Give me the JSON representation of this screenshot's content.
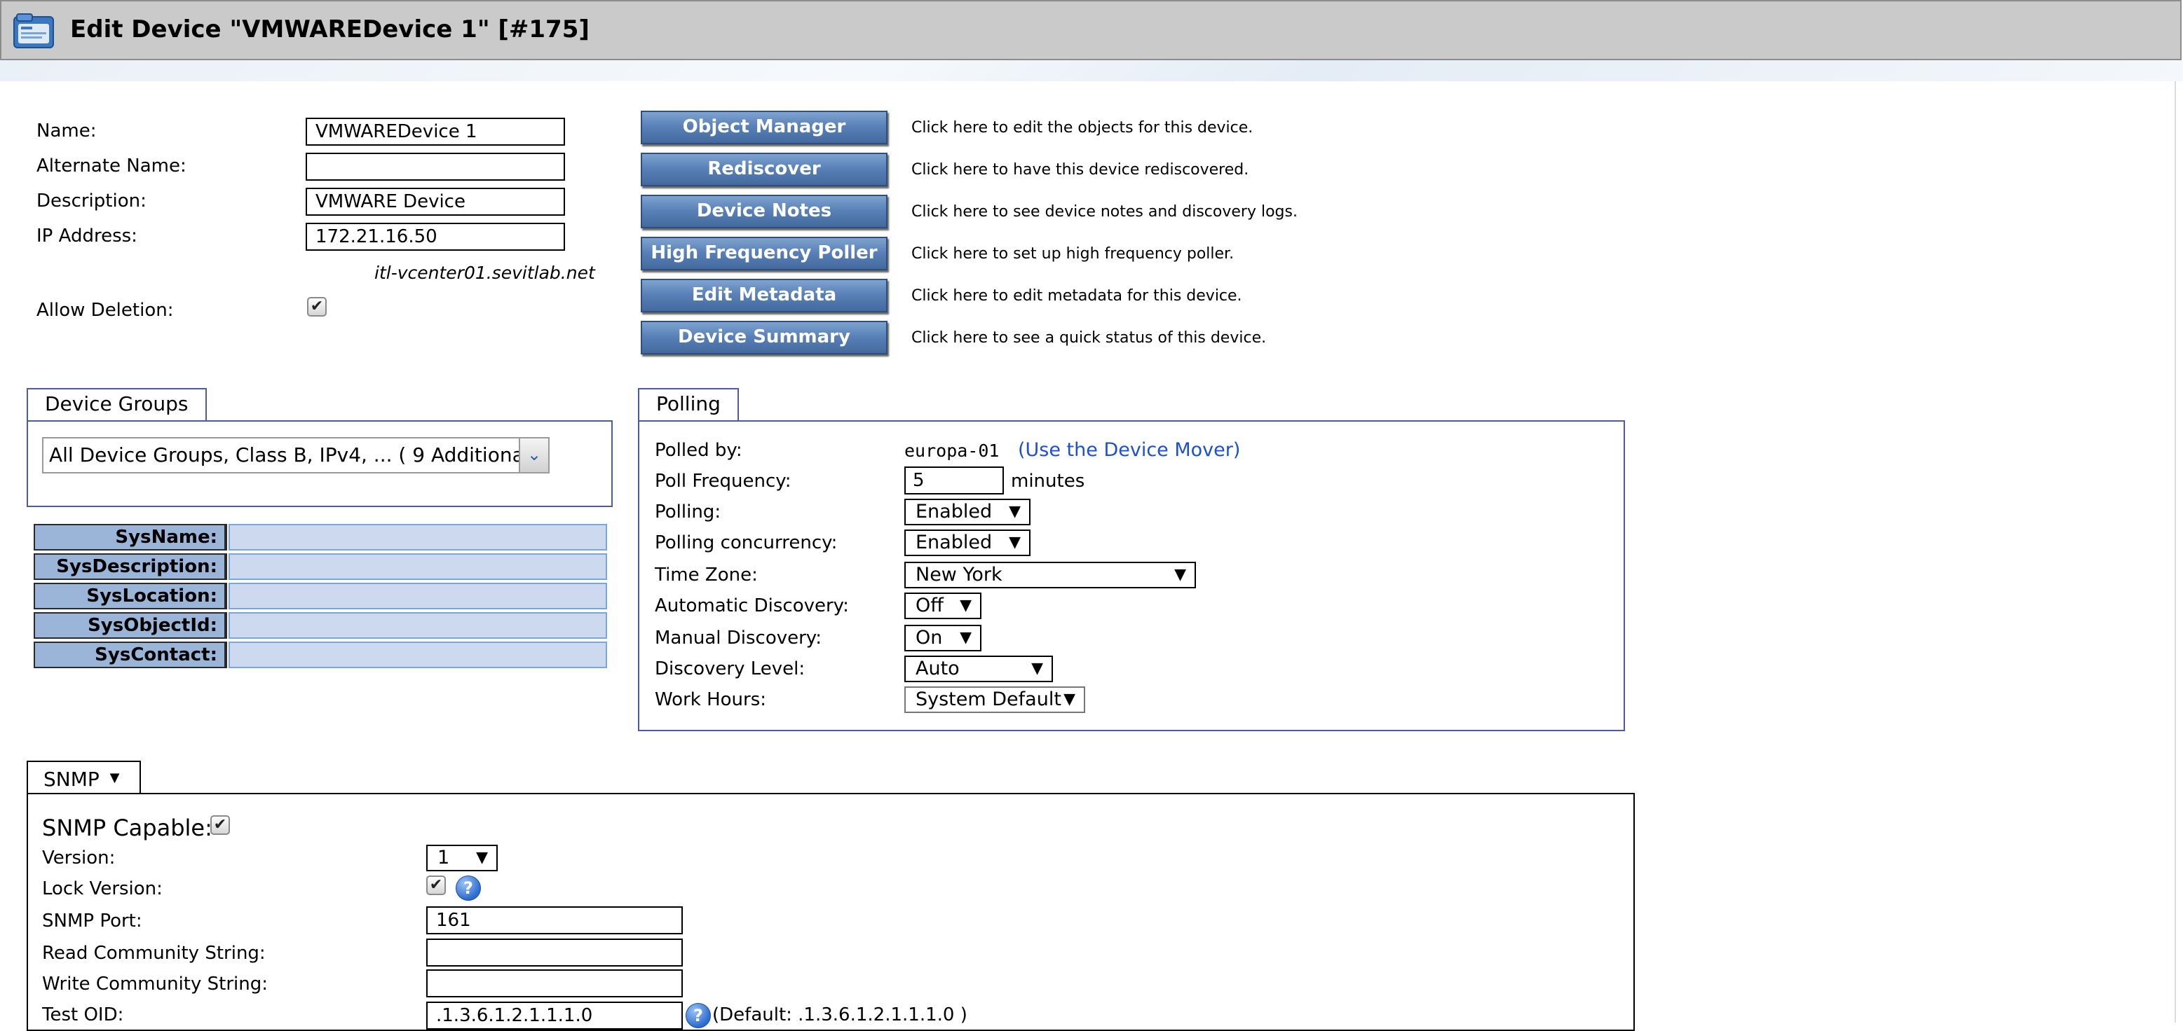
{
  "window": {
    "title": "Edit Device \"VMWAREDevice 1\" [#175]",
    "icon": "device-folder-icon"
  },
  "device_form": {
    "name_label": "Name:",
    "name_value": "VMWAREDevice 1",
    "alt_name_label": "Alternate Name:",
    "alt_name_value": "",
    "description_label": "Description:",
    "description_value": "VMWARE Device",
    "ip_label": "IP Address:",
    "ip_value": "172.21.16.50",
    "hostname": "itl-vcenter01.sevitlab.net",
    "allow_deletion_label": "Allow Deletion:",
    "allow_deletion_checked": true
  },
  "actions": [
    {
      "label": "Object Manager",
      "desc": "Click here to edit the objects for this device."
    },
    {
      "label": "Rediscover",
      "desc": "Click here to have this device rediscovered."
    },
    {
      "label": "Device Notes",
      "desc": "Click here to see device notes and discovery logs."
    },
    {
      "label": "High Frequency Poller",
      "desc": "Click here to set up high frequency poller."
    },
    {
      "label": "Edit Metadata",
      "desc": "Click here to edit metadata for this device."
    },
    {
      "label": "Device Summary",
      "desc": "Click here to see a quick status of this device."
    }
  ],
  "device_groups": {
    "tab_label": "Device Groups",
    "selected": "All Device Groups, Class B, IPv4, ... ( 9 Additional"
  },
  "sys_info": [
    {
      "label": "SysName:",
      "value": ""
    },
    {
      "label": "SysDescription:",
      "value": ""
    },
    {
      "label": "SysLocation:",
      "value": ""
    },
    {
      "label": "SysObjectId:",
      "value": ""
    },
    {
      "label": "SysContact:",
      "value": ""
    }
  ],
  "polling": {
    "tab_label": "Polling",
    "polled_by_label": "Polled by:",
    "polled_by_value": "europa-01",
    "device_mover_link": "(Use the Device Mover)",
    "poll_frequency_label": "Poll Frequency:",
    "poll_frequency_value": "5",
    "poll_frequency_unit": "minutes",
    "polling_label": "Polling:",
    "polling_value": "Enabled",
    "concurrency_label": "Polling concurrency:",
    "concurrency_value": "Enabled",
    "timezone_label": "Time Zone:",
    "timezone_value": "New York",
    "auto_discovery_label": "Automatic Discovery:",
    "auto_discovery_value": "Off",
    "manual_discovery_label": "Manual Discovery:",
    "manual_discovery_value": "On",
    "discovery_level_label": "Discovery Level:",
    "discovery_level_value": "Auto",
    "work_hours_label": "Work Hours:",
    "work_hours_value": "System Default"
  },
  "snmp": {
    "tab_label": "SNMP",
    "capable_label": "SNMP Capable:",
    "capable_checked": true,
    "version_label": "Version:",
    "version_value": "1",
    "lock_version_label": "Lock Version:",
    "lock_version_checked": true,
    "port_label": "SNMP Port:",
    "port_value": "161",
    "read_community_label": "Read Community String:",
    "read_community_value": "",
    "write_community_label": "Write Community String:",
    "write_community_value": "",
    "test_oid_label": "Test OID:",
    "test_oid_value": ".1.3.6.1.2.1.1.1.0",
    "test_oid_default": "(Default: .1.3.6.1.2.1.1.1.0 )"
  },
  "colors": {
    "button_blue": "#5a82b8",
    "link_blue": "#1a4fd6",
    "panel_border": "#4a5f9a",
    "sys_label_bg": "#9bb5d9",
    "sys_value_bg": "#cdd9ee",
    "title_bar_bg": "#cacaca"
  }
}
